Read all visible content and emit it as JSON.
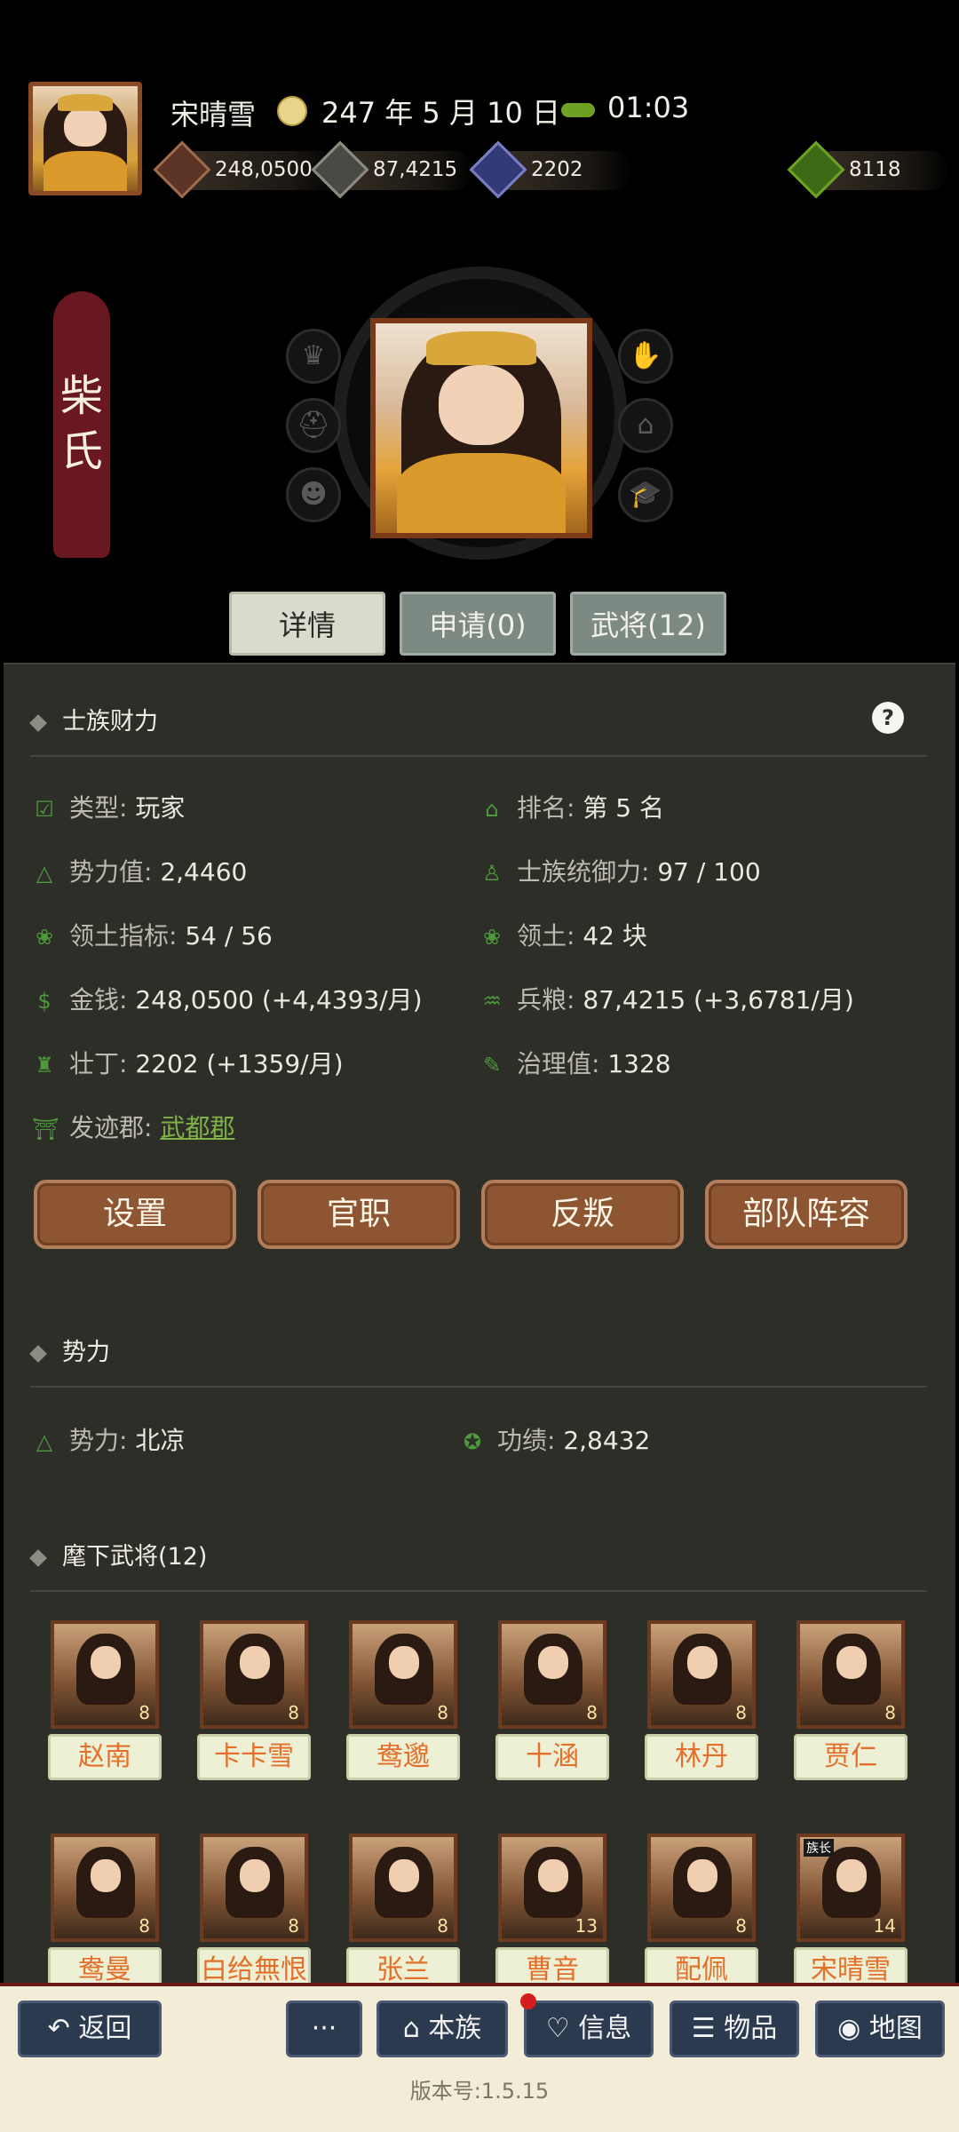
{
  "header": {
    "player_name": "宋晴雪",
    "date": "247 年 5 月 10 日",
    "time": "01:03",
    "resources": {
      "money": "248,0500",
      "grain": "87,4215",
      "soldiers": "2202",
      "special": "8118"
    }
  },
  "clan": {
    "name_chars": [
      "柴",
      "氏"
    ]
  },
  "side_icons": [
    "crown-icon",
    "helmet-icon",
    "mask-icon",
    "hand-coin-icon",
    "hat-icon",
    "scholar-cap-icon"
  ],
  "tabs": [
    {
      "label": "详情",
      "active": true
    },
    {
      "label": "申请(0)",
      "active": false
    },
    {
      "label": "武将(12)",
      "active": false
    }
  ],
  "sections": {
    "wealth": {
      "title": "士族财力",
      "help": "?",
      "rows": [
        {
          "key": "类型:",
          "value": "玩家"
        },
        {
          "key": "排名:",
          "value": "第 5 名"
        },
        {
          "key": "势力值:",
          "value": "2,4460"
        },
        {
          "key": "士族统御力:",
          "value": "97 / 100"
        },
        {
          "key": "领土指标:",
          "value": "54 / 56"
        },
        {
          "key": "领土:",
          "value": "42 块"
        },
        {
          "key": "金钱:",
          "value": "248,0500 (+4,4393/月)"
        },
        {
          "key": "兵粮:",
          "value": "87,4215 (+3,6781/月)"
        },
        {
          "key": "壮丁:",
          "value": "2202 (+1359/月)"
        },
        {
          "key": "治理值:",
          "value": "1328"
        },
        {
          "key": "发迹郡:",
          "value": "武都郡"
        }
      ]
    },
    "actions": [
      "设置",
      "官职",
      "反叛",
      "部队阵容"
    ],
    "power": {
      "title": "势力",
      "rows": [
        {
          "key": "势力:",
          "value": "北凉"
        },
        {
          "key": "功绩:",
          "value": "2,8432"
        }
      ]
    },
    "generals": {
      "title": "麾下武将(12)",
      "list": [
        {
          "name": "赵南",
          "cost": "8"
        },
        {
          "name": "卡卡雪",
          "cost": "8"
        },
        {
          "name": "鸯邈",
          "cost": "8"
        },
        {
          "name": "十涵",
          "cost": "8"
        },
        {
          "name": "林丹",
          "cost": "8"
        },
        {
          "name": "贾仁",
          "cost": "8"
        },
        {
          "name": "鸯曼",
          "cost": "8"
        },
        {
          "name": "白给無恨",
          "cost": "8"
        },
        {
          "name": "张兰",
          "cost": "8"
        },
        {
          "name": "曹音",
          "cost": "13"
        },
        {
          "name": "配佩",
          "cost": "8"
        },
        {
          "name": "宋晴雪",
          "cost": "14",
          "tag": "族长"
        }
      ]
    }
  },
  "bottom_nav": {
    "back": "返回",
    "more": "···",
    "clan": "本族",
    "info": "信息",
    "items": "物品",
    "map": "地图"
  },
  "version": "版本号:1.5.15"
}
